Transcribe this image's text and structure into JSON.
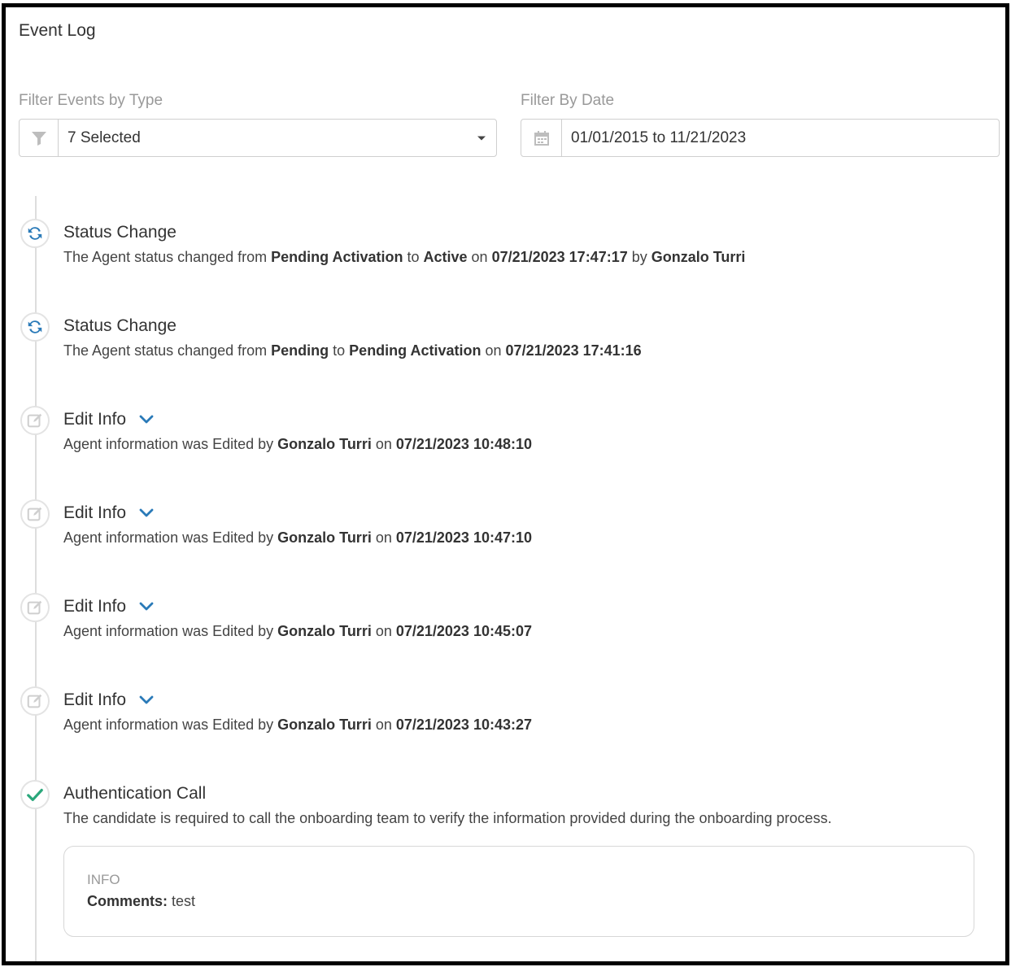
{
  "page": {
    "title": "Event Log"
  },
  "filters": {
    "type": {
      "label": "Filter Events by Type",
      "value": "7 Selected"
    },
    "date": {
      "label": "Filter By Date",
      "value": "01/01/2015 to 11/21/2023"
    }
  },
  "events": [
    {
      "icon": "refresh-icon",
      "title": "Status Change",
      "parts": [
        {
          "t": "The Agent status changed from "
        },
        {
          "b": "Pending Activation"
        },
        {
          "t": " to "
        },
        {
          "b": "Active"
        },
        {
          "t": " on "
        },
        {
          "b": "07/21/2023 17:47:17"
        },
        {
          "t": " by "
        },
        {
          "b": "Gonzalo Turri"
        }
      ]
    },
    {
      "icon": "refresh-icon",
      "title": "Status Change",
      "parts": [
        {
          "t": "The Agent status changed from "
        },
        {
          "b": "Pending"
        },
        {
          "t": " to "
        },
        {
          "b": "Pending Activation"
        },
        {
          "t": " on "
        },
        {
          "b": "07/21/2023 17:41:16"
        }
      ]
    },
    {
      "icon": "edit-icon",
      "title": "Edit Info",
      "parts": [
        {
          "t": "Agent information was Edited by "
        },
        {
          "b": "Gonzalo Turri"
        },
        {
          "t": " on "
        },
        {
          "b": "07/21/2023 10:48:10"
        }
      ]
    },
    {
      "icon": "edit-icon",
      "title": "Edit Info",
      "parts": [
        {
          "t": "Agent information was Edited by "
        },
        {
          "b": "Gonzalo Turri"
        },
        {
          "t": " on "
        },
        {
          "b": "07/21/2023 10:47:10"
        }
      ]
    },
    {
      "icon": "edit-icon",
      "title": "Edit Info",
      "parts": [
        {
          "t": "Agent information was Edited by "
        },
        {
          "b": "Gonzalo Turri"
        },
        {
          "t": " on "
        },
        {
          "b": "07/21/2023 10:45:07"
        }
      ]
    },
    {
      "icon": "edit-icon",
      "title": "Edit Info",
      "parts": [
        {
          "t": "Agent information was Edited by "
        },
        {
          "b": "Gonzalo Turri"
        },
        {
          "t": " on "
        },
        {
          "b": "07/21/2023 10:43:27"
        }
      ]
    },
    {
      "icon": "check-icon",
      "title": "Authentication Call",
      "parts": [
        {
          "t": "The candidate is required to call the onboarding team to verify the information provided during the onboarding process."
        }
      ]
    }
  ],
  "info": {
    "heading": "INFO",
    "comment_label": "Comments:",
    "comment_value": " test"
  },
  "colors": {
    "accent": "#2a7ab8",
    "success": "#2aa77b",
    "muted_icon": "#cfcfcf"
  }
}
